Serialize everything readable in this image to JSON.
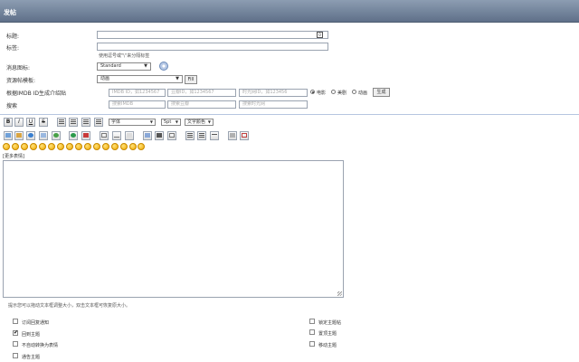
{
  "header": {
    "title": "发帖"
  },
  "form": {
    "title_label": "标题:",
    "title_counter": "0",
    "tags_label": "标签:",
    "tags_hint": "使用逗号或\"\\\"来分隔标签",
    "icon_label": "消息图标:",
    "icon_value": "Standard",
    "template_label": "资源帖模板:",
    "template_value": "动画",
    "fill_label": "Fill",
    "imdb_label": "根据IMDB ID生成介绍贴",
    "imdb_placeholder": "IMDB ID，如1234567",
    "douban_placeholder": "豆瓣ID，如1234567",
    "mtime_placeholder": "时光网ID，如123456",
    "radio_options": [
      "电影",
      "美剧",
      "动画"
    ],
    "radio_selected": "电影",
    "generate_label": "生成",
    "search_label": "搜索",
    "search_imdb_placeholder": "搜索IMDB",
    "search_douban_placeholder": "搜索豆瓣",
    "search_mtime_placeholder": "搜索时光网"
  },
  "editor": {
    "font_select": "字体",
    "size_select": "5pt",
    "color_select": "文字颜色",
    "more_smilies": "[更多表情]",
    "resize_tip": "提示您可以拖动文本框调整大小，双击文本框可恢复原大小。"
  },
  "options": {
    "left": [
      {
        "label": "订阅回复通知",
        "checked": false
      },
      {
        "label": "回到主题",
        "checked": true
      },
      {
        "label": "不自动转换为表情",
        "checked": false
      },
      {
        "label": "通告主题",
        "checked": false
      }
    ],
    "right": [
      {
        "label": "锁定主题帖",
        "checked": false
      },
      {
        "label": "置顶主题",
        "checked": false
      },
      {
        "label": "移动主题",
        "checked": false
      }
    ]
  },
  "colors": {
    "header_top": "#8c9db2",
    "header_bottom": "#5f7089",
    "separator": "#b6c6e0"
  }
}
